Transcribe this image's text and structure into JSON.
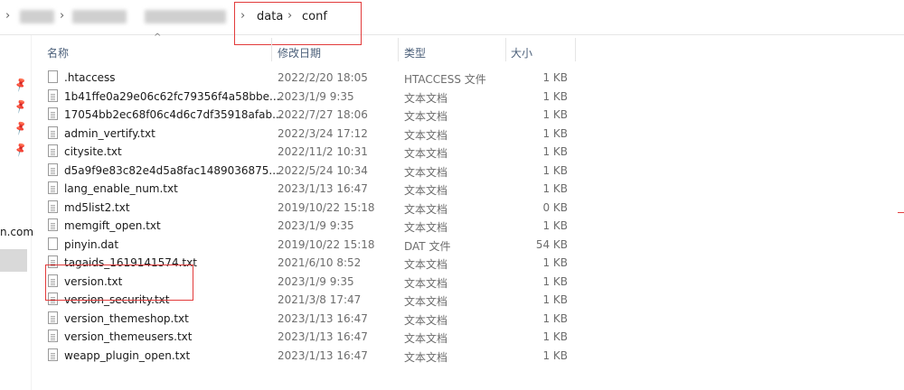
{
  "breadcrumb": {
    "parts": [
      "data",
      "conf"
    ]
  },
  "sidebar": {
    "partial_label": "n.com"
  },
  "columns": {
    "name": "名称",
    "modified": "修改日期",
    "type": "类型",
    "size": "大小"
  },
  "files": [
    {
      "name": ".htaccess",
      "modified": "2022/2/20 18:05",
      "type": "HTACCESS 文件",
      "size": "1 KB",
      "icon": "blank-file-icon"
    },
    {
      "name": "1b41ffe0a29e06c62fc79356f4a58bbe....",
      "modified": "2023/1/9 9:35",
      "type": "文本文档",
      "size": "1 KB",
      "icon": "text-file-icon"
    },
    {
      "name": "17054bb2ec68f06c4d6c7df35918afab...",
      "modified": "2022/7/27 18:06",
      "type": "文本文档",
      "size": "1 KB",
      "icon": "text-file-icon"
    },
    {
      "name": "admin_vertify.txt",
      "modified": "2022/3/24 17:12",
      "type": "文本文档",
      "size": "1 KB",
      "icon": "text-file-icon"
    },
    {
      "name": "citysite.txt",
      "modified": "2022/11/2 10:31",
      "type": "文本文档",
      "size": "1 KB",
      "icon": "text-file-icon"
    },
    {
      "name": "d5a9f9e83c82e4d5a8fac1489036875...",
      "modified": "2022/5/24 10:34",
      "type": "文本文档",
      "size": "1 KB",
      "icon": "text-file-icon"
    },
    {
      "name": "lang_enable_num.txt",
      "modified": "2023/1/13 16:47",
      "type": "文本文档",
      "size": "1 KB",
      "icon": "text-file-icon"
    },
    {
      "name": "md5list2.txt",
      "modified": "2019/10/22 15:18",
      "type": "文本文档",
      "size": "0 KB",
      "icon": "text-file-icon"
    },
    {
      "name": "memgift_open.txt",
      "modified": "2023/1/9 9:35",
      "type": "文本文档",
      "size": "1 KB",
      "icon": "text-file-icon"
    },
    {
      "name": "pinyin.dat",
      "modified": "2019/10/22 15:18",
      "type": "DAT 文件",
      "size": "54 KB",
      "icon": "blank-file-icon"
    },
    {
      "name": "tagaids_1619141574.txt",
      "modified": "2021/6/10 8:52",
      "type": "文本文档",
      "size": "1 KB",
      "icon": "text-file-icon"
    },
    {
      "name": "version.txt",
      "modified": "2023/1/9 9:35",
      "type": "文本文档",
      "size": "1 KB",
      "icon": "text-file-icon"
    },
    {
      "name": "version_security.txt",
      "modified": "2021/3/8 17:47",
      "type": "文本文档",
      "size": "1 KB",
      "icon": "text-file-icon"
    },
    {
      "name": "version_themeshop.txt",
      "modified": "2023/1/13 16:47",
      "type": "文本文档",
      "size": "1 KB",
      "icon": "text-file-icon"
    },
    {
      "name": "version_themeusers.txt",
      "modified": "2023/1/13 16:47",
      "type": "文本文档",
      "size": "1 KB",
      "icon": "text-file-icon"
    },
    {
      "name": "weapp_plugin_open.txt",
      "modified": "2023/1/13 16:47",
      "type": "文本文档",
      "size": "1 KB",
      "icon": "text-file-icon"
    }
  ],
  "highlight_color": "#e23b3b"
}
